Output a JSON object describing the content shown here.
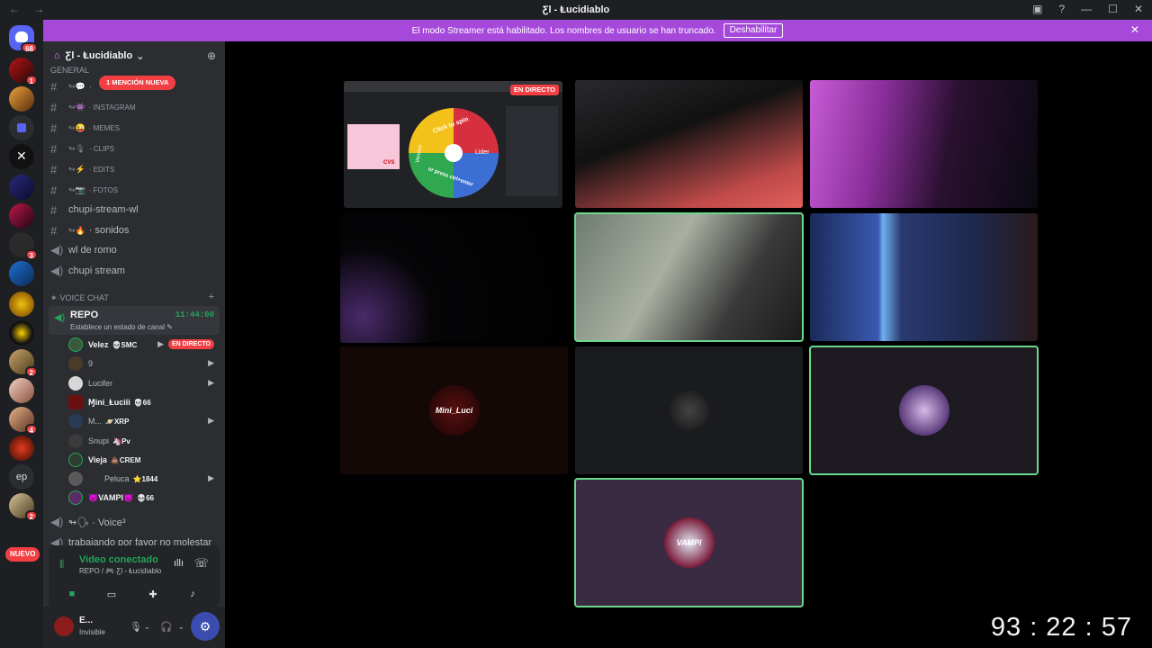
{
  "window": {
    "title": "Ƹl - Ⱡucidiablo",
    "nav_glyphs": "← →",
    "controls": [
      "▣",
      "?",
      "—",
      "☐",
      "✕"
    ]
  },
  "server_bar": {
    "home_badge": "68",
    "badges": [
      "1",
      "3",
      "2",
      "4",
      "2"
    ],
    "new_pill": "NUEVO",
    "ep_label": "ep"
  },
  "banner": {
    "text": "El modo Streamer está habilitado. Los nombres de usuario se han truncado.",
    "button_label": "Deshabilitar",
    "close": "✕"
  },
  "guild": {
    "name": "Ƹl - Ⱡucidiablo",
    "chevron": "⌄",
    "add_member_icon": "person-add-icon"
  },
  "channels": {
    "category_general": "GENERAL",
    "mention_pill": "1 MENCIÓN NUEVA",
    "items": [
      {
        "emoji": "↬💬",
        "label": "·"
      },
      {
        "emoji": "↬👾",
        "label": "· INSTAGRAM"
      },
      {
        "emoji": "↬😜",
        "label": "· MEMES"
      },
      {
        "emoji": "↬🎙",
        "label": "· CLIPS"
      },
      {
        "emoji": "↬⚡",
        "label": "· EDITS"
      },
      {
        "emoji": "↬📷",
        "label": "· FOTOS"
      },
      {
        "emoji": "",
        "label": "chupi-stream-wl"
      },
      {
        "emoji": "↬🔥",
        "label": "· sonidos"
      }
    ],
    "voice_simple": [
      "wl de romo",
      "chupi stream"
    ],
    "category_voice": "✶·VOICE CHAT",
    "repo": {
      "name": "REPO",
      "time": "11:44:00",
      "status": "Establece un estado de canal ✎"
    },
    "members": [
      {
        "name": "Velez",
        "tag": "💀SMC",
        "live": "EN DIRECTO"
      },
      {
        "name": "9",
        "tag": "",
        "live": ""
      },
      {
        "name": "Lucifer",
        "tag": "",
        "live": ""
      },
      {
        "name": "Ɱini_Ⱡuciii",
        "tag": "💀66",
        "live": ""
      },
      {
        "name": "M...",
        "tag": "🪐XRP",
        "live": ""
      },
      {
        "name": "Snupi",
        "tag": "🦄Pv",
        "live": ""
      },
      {
        "name": "Vieja",
        "tag": "💩CREM",
        "live": ""
      },
      {
        "name": "Peluca",
        "tag": "⭐1844",
        "live": ""
      },
      {
        "name": "👿VAMPI👿",
        "tag": "💀66",
        "live": ""
      }
    ],
    "after_voice": [
      "↬🗣 · Voice³",
      "trabajando por favor no molestar"
    ]
  },
  "voice_panel": {
    "status": "Video conectado",
    "sub": "REPO / 🎮 Ƹl - Ⱡucidiablo",
    "buttons": [
      "camera-icon",
      "screen-share-icon",
      "activities-icon",
      "soundboard-icon"
    ]
  },
  "user_panel": {
    "name": "E...",
    "status": "Invisible"
  },
  "stage": {
    "live_badge": "EN DIRECTO",
    "wheel_labels": [
      "Click to spin",
      "Lider",
      "Veneco",
      "or press ctrl+enter"
    ],
    "screen_promo": "CVS",
    "tile_logos": [
      "Mini_Luci",
      "",
      "",
      "VAMPI"
    ]
  },
  "timer": "93 : 22 : 57",
  "colors": {
    "accent": "#a649db",
    "live": "#f23f43",
    "speaking": "#6bd88f",
    "online": "#23a559"
  }
}
